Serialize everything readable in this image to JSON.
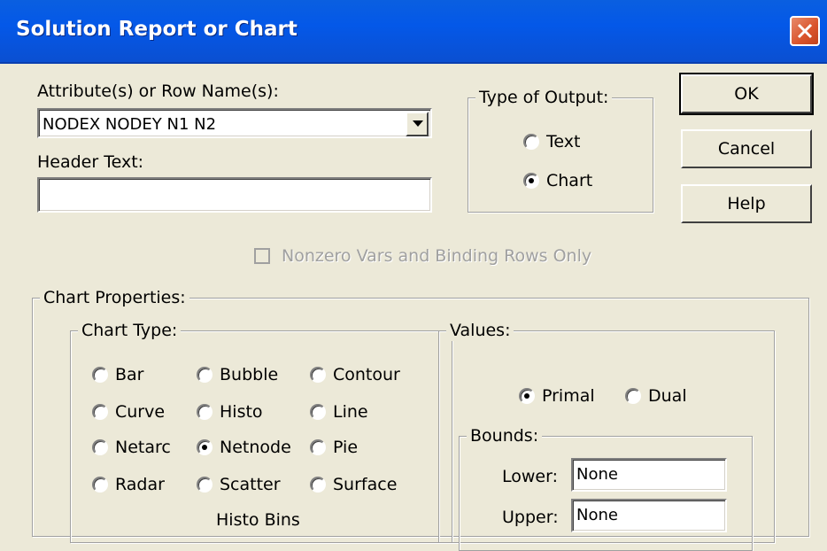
{
  "window": {
    "title": "Solution Report or Chart"
  },
  "attributes": {
    "label": "Attribute(s) or Row Name(s):",
    "value": "NODEX NODEY N1 N2"
  },
  "header": {
    "label": "Header Text:",
    "value": ""
  },
  "output_type": {
    "title": "Type of Output:",
    "options": [
      {
        "label": "Text",
        "selected": false
      },
      {
        "label": "Chart",
        "selected": true
      }
    ]
  },
  "buttons": {
    "ok": "OK",
    "cancel": "Cancel",
    "help": "Help"
  },
  "nonzero": {
    "label": "Nonzero Vars and Binding Rows Only",
    "checked": false,
    "enabled": false
  },
  "chart_properties": {
    "title": "Chart Properties:",
    "chart_type": {
      "title": "Chart Type:",
      "options": [
        {
          "label": "Bar",
          "selected": false
        },
        {
          "label": "Bubble",
          "selected": false
        },
        {
          "label": "Contour",
          "selected": false
        },
        {
          "label": "Curve",
          "selected": false
        },
        {
          "label": "Histo",
          "selected": false
        },
        {
          "label": "Line",
          "selected": false
        },
        {
          "label": "Netarc",
          "selected": false
        },
        {
          "label": "Netnode",
          "selected": true
        },
        {
          "label": "Pie",
          "selected": false
        },
        {
          "label": "Radar",
          "selected": false
        },
        {
          "label": "Scatter",
          "selected": false
        },
        {
          "label": "Surface",
          "selected": false
        }
      ]
    },
    "values": {
      "title": "Values:",
      "options": [
        {
          "label": "Primal",
          "selected": true
        },
        {
          "label": "Dual",
          "selected": false
        }
      ],
      "bounds": {
        "title": "Bounds:",
        "lower_label": "Lower:",
        "lower_value": "None",
        "upper_label": "Upper:",
        "upper_value": "None"
      }
    }
  },
  "partial_label": "Histo Bins"
}
